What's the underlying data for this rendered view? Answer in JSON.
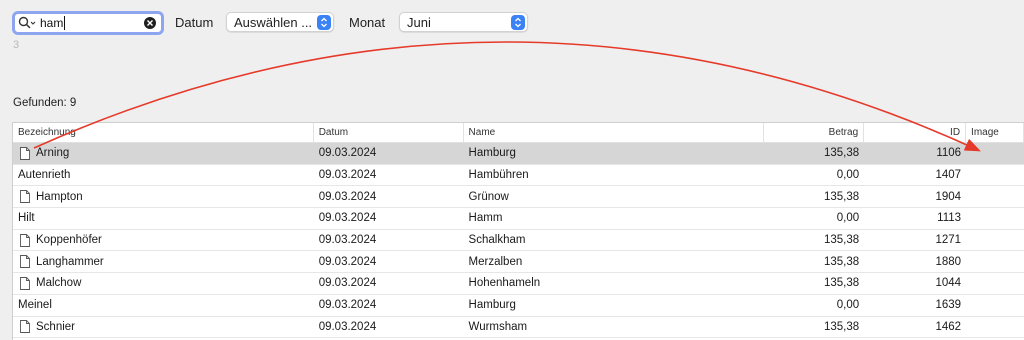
{
  "search": {
    "value": "ham"
  },
  "filters": {
    "datum_label": "Datum",
    "datum_value": "Auswählen ...",
    "monat_label": "Monat",
    "monat_value": "Juni"
  },
  "faint_number": "3",
  "found_text": "Gefunden: 9",
  "table": {
    "columns": [
      "Bezeichnung",
      "Datum",
      "Name",
      "Betrag",
      "ID",
      "Image"
    ],
    "rows": [
      {
        "bezeichnung": "Arning",
        "doc": true,
        "datum": "09.03.2024",
        "name": "Hamburg",
        "betrag": "135,38",
        "id": "1106",
        "image": "",
        "selected": true
      },
      {
        "bezeichnung": "Autenrieth",
        "doc": false,
        "datum": "09.03.2024",
        "name": "Hambühren",
        "betrag": "0,00",
        "id": "1407",
        "image": ""
      },
      {
        "bezeichnung": "Hampton",
        "doc": true,
        "datum": "09.03.2024",
        "name": "Grünow",
        "betrag": "135,38",
        "id": "1904",
        "image": ""
      },
      {
        "bezeichnung": "Hilt",
        "doc": false,
        "datum": "09.03.2024",
        "name": "Hamm",
        "betrag": "0,00",
        "id": "1113",
        "image": ""
      },
      {
        "bezeichnung": "Koppenhöfer",
        "doc": true,
        "datum": "09.03.2024",
        "name": "Schalkham",
        "betrag": "135,38",
        "id": "1271",
        "image": ""
      },
      {
        "bezeichnung": "Langhammer",
        "doc": true,
        "datum": "09.03.2024",
        "name": "Merzalben",
        "betrag": "135,38",
        "id": "1880",
        "image": ""
      },
      {
        "bezeichnung": "Malchow",
        "doc": true,
        "datum": "09.03.2024",
        "name": "Hohenhameln",
        "betrag": "135,38",
        "id": "1044",
        "image": ""
      },
      {
        "bezeichnung": "Meinel",
        "doc": false,
        "datum": "09.03.2024",
        "name": "Hamburg",
        "betrag": "0,00",
        "id": "1639",
        "image": ""
      },
      {
        "bezeichnung": "Schnier",
        "doc": true,
        "datum": "09.03.2024",
        "name": "Wurmsham",
        "betrag": "135,38",
        "id": "1462",
        "image": ""
      }
    ]
  },
  "colors": {
    "accent": "#3b82f6",
    "focus_ring": "#8ea6ef",
    "selected_row": "#d6d6d6",
    "annotation_arrow": "#e53a2a"
  },
  "icons": [
    "search-icon",
    "chevron-down-icon",
    "clear-icon",
    "document-icon",
    "up-down-chevron-icon"
  ]
}
